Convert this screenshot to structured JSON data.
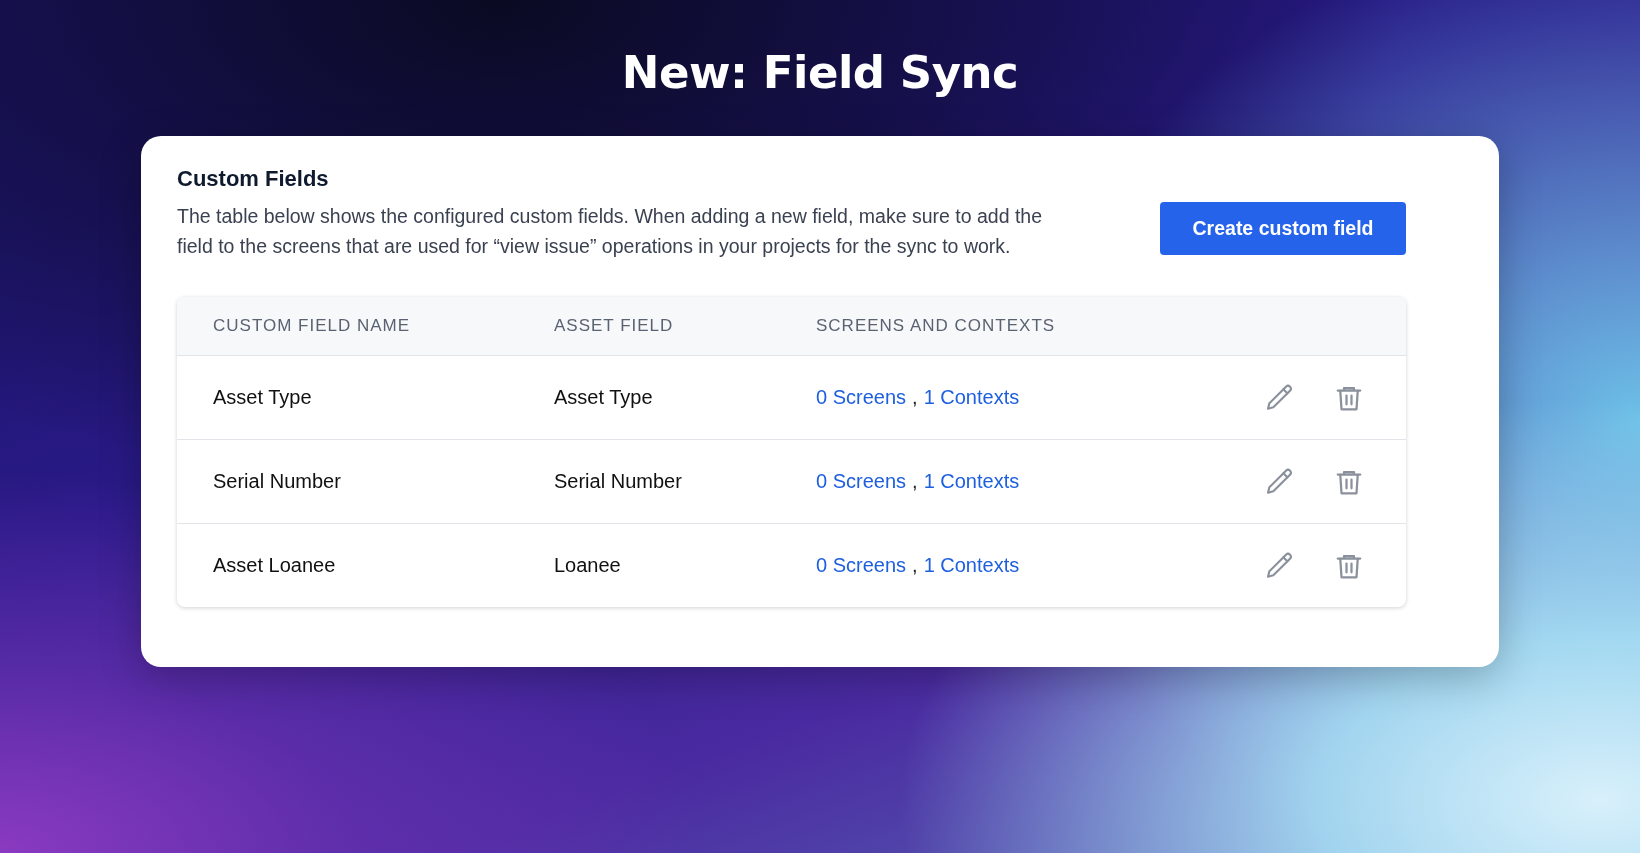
{
  "headline": "New: Field Sync",
  "panel": {
    "title": "Custom Fields",
    "description": "The table below shows the configured custom fields. When adding a new field, make sure to add the field to the screens that are used for “view issue” operations in your projects for the sync to work.",
    "create_button": "Create custom field"
  },
  "table": {
    "columns": [
      "CUSTOM FIELD NAME",
      "ASSET FIELD",
      "SCREENS AND CONTEXTS"
    ],
    "rows": [
      {
        "name": "Asset Type",
        "asset_field": "Asset Type",
        "screens": "0 Screens",
        "separator": ",",
        "contexts": "1 Contexts"
      },
      {
        "name": "Serial Number",
        "asset_field": "Serial Number",
        "screens": "0 Screens",
        "separator": ",",
        "contexts": "1 Contexts"
      },
      {
        "name": "Asset Loanee",
        "asset_field": "Loanee",
        "screens": "0 Screens",
        "separator": ",",
        "contexts": "1 Contexts"
      }
    ]
  }
}
